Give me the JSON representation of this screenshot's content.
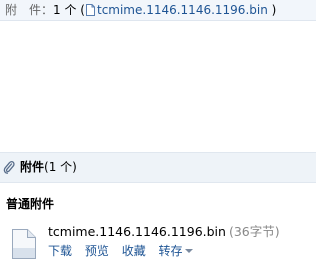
{
  "top_bar": {
    "label": "附　件：",
    "count": "1 个",
    "paren_open": "(",
    "file_name": "tcmime.1146.1146.1196.bin",
    "paren_close": ")",
    "file_icon": "document-icon"
  },
  "attachments": {
    "header_icon": "paperclip-icon",
    "title": "附件",
    "count": "(1 个)",
    "section_label": "普通附件",
    "files": [
      {
        "icon": "file-icon",
        "name": "tcmime.1146.1146.1196.bin",
        "size": "(36字节)",
        "actions": {
          "download": "下载",
          "preview": "预览",
          "favorite": "收藏",
          "forward": "转存"
        }
      }
    ]
  }
}
